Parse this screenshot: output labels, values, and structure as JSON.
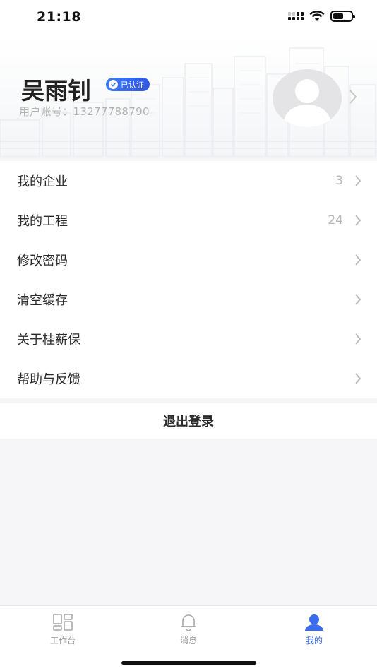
{
  "status_bar": {
    "time": "21:18"
  },
  "profile": {
    "name": "吴雨钊",
    "badge": "已认证",
    "account_label": "用户账号：",
    "account_number": "13277788790"
  },
  "menu": {
    "items": [
      {
        "label": "我的企业",
        "count": "3"
      },
      {
        "label": "我的工程",
        "count": "24"
      },
      {
        "label": "修改密码",
        "count": ""
      },
      {
        "label": "清空缓存",
        "count": ""
      },
      {
        "label": "关于桂薪保",
        "count": ""
      },
      {
        "label": "帮助与反馈",
        "count": ""
      }
    ]
  },
  "logout": {
    "label": "退出登录"
  },
  "tabbar": {
    "tabs": [
      {
        "label": "工作台",
        "icon": "workbench-grid-icon"
      },
      {
        "label": "消息",
        "icon": "bell-icon"
      },
      {
        "label": "我的",
        "icon": "person-icon"
      }
    ],
    "active_color": "#3a6cf0",
    "inactive_color": "#9a9a9a"
  },
  "colors": {
    "badge": "#3f7bf7",
    "background": "#f6f6f8"
  }
}
